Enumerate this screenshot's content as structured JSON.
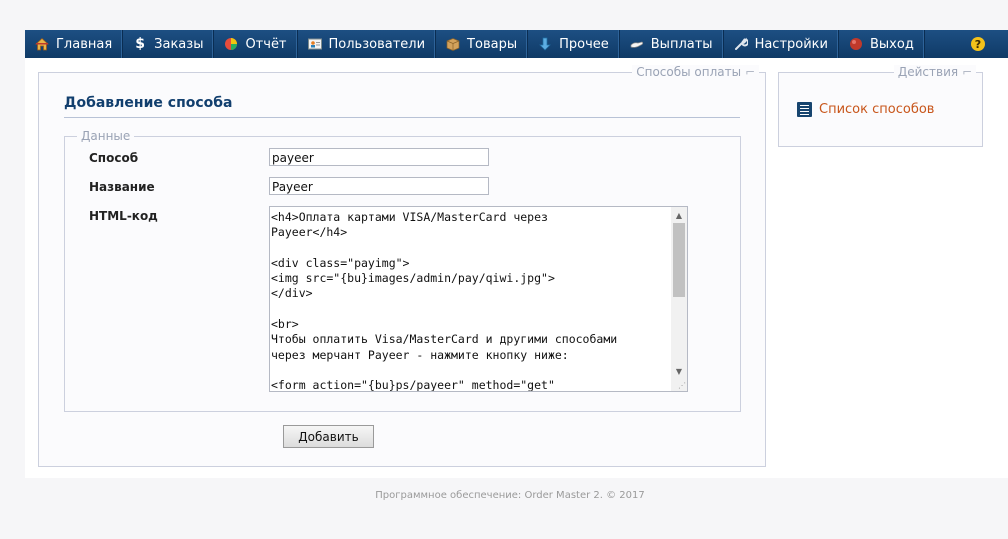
{
  "nav": {
    "items": [
      {
        "label": "Главная",
        "icon": "home-icon"
      },
      {
        "label": "Заказы",
        "icon": "dollar-icon"
      },
      {
        "label": "Отчёт",
        "icon": "pie-chart-icon"
      },
      {
        "label": "Пользователи",
        "icon": "users-card-icon"
      },
      {
        "label": "Товары",
        "icon": "box-icon"
      },
      {
        "label": "Прочее",
        "icon": "arrow-down-icon"
      },
      {
        "label": "Выплаты",
        "icon": "hand-icon"
      },
      {
        "label": "Настройки",
        "icon": "wrench-icon"
      },
      {
        "label": "Выход",
        "icon": "red-circle-icon"
      }
    ],
    "help_symbol": "?"
  },
  "main_panel": {
    "legend": "Способы оплаты",
    "title": "Добавление способа",
    "data_legend": "Данные",
    "fields": {
      "method_label": "Способ",
      "method_value": "payeer",
      "name_label": "Название",
      "name_value": "Payeer",
      "html_label": "HTML-код",
      "html_value": "<h4>Оплата картами VISA/MasterCard через\nPayeer</h4>\n\n<div class=\"payimg\">\n<img src=\"{bu}images/admin/pay/qiwi.jpg\">\n</div>\n\n<br>\nЧтобы оплатить Visa/MasterCard и другими способами\nчерез мерчант Payeer - нажмите кнопку ниже:\n\n<form action=\"{bu}ps/payeer\" method=\"get\""
    },
    "submit_label": "Добавить"
  },
  "side_panel": {
    "legend": "Действия",
    "link_label": "Список способов"
  },
  "footer": {
    "text": "Программное обеспечение: Order Master 2. © 2017"
  },
  "colors": {
    "nav_bg": "#143f6c",
    "title": "#123f6e",
    "link": "#c8561b"
  }
}
